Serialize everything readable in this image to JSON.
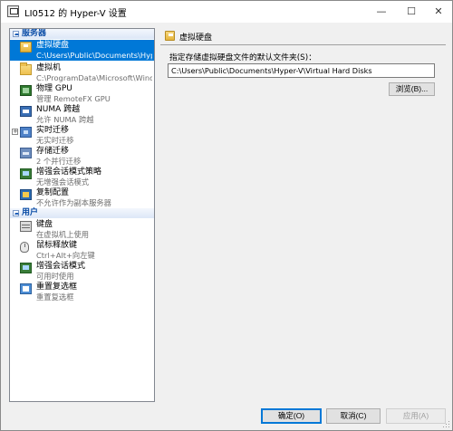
{
  "window": {
    "title": "LI0512 的 Hyper-V 设置",
    "controls": {
      "minimize": "—",
      "maximize": "☐",
      "close": "✕"
    }
  },
  "sidebar": {
    "sections": [
      {
        "label": "服务器"
      },
      {
        "label": "用户"
      }
    ],
    "items": [
      {
        "name": "虚拟硬盘",
        "sub": "C:\\Users\\Public\\Documents\\Hyper-...",
        "icon": "virtual-disk-icon",
        "selected": true
      },
      {
        "name": "虚拟机",
        "sub": "C:\\ProgramData\\Microsoft\\Windo...",
        "icon": "folder-icon"
      },
      {
        "name": "物理 GPU",
        "sub": "管理 RemoteFX GPU",
        "icon": "gpu-icon"
      },
      {
        "name": "NUMA 跨越",
        "sub": "允许 NUMA 跨越",
        "icon": "numa-icon"
      },
      {
        "name": "实时迁移",
        "sub": "无实时迁移",
        "icon": "live-migration-icon",
        "expandable": true
      },
      {
        "name": "存储迁移",
        "sub": "2 个并行迁移",
        "icon": "storage-migration-icon"
      },
      {
        "name": "增强会话模式策略",
        "sub": "无增强会话模式",
        "icon": "session-policy-icon"
      },
      {
        "name": "复制配置",
        "sub": "不允许作为副本服务器",
        "icon": "replication-icon"
      },
      {
        "name": "键盘",
        "sub": "在虚拟机上使用",
        "icon": "keyboard-icon"
      },
      {
        "name": "鼠标释放键",
        "sub": "Ctrl+Alt+向左键",
        "icon": "mouse-icon"
      },
      {
        "name": "增强会话模式",
        "sub": "可用时使用",
        "icon": "enhanced-session-icon"
      },
      {
        "name": "重置复选框",
        "sub": "重置复选框",
        "icon": "reset-checkbox-icon"
      }
    ]
  },
  "main": {
    "title": "虚拟硬盘",
    "field_label": "指定存储虚拟硬盘文件的默认文件夹(S)：",
    "path_value": "C:\\Users\\Public\\Documents\\Hyper-V\\Virtual Hard Disks",
    "browse_label": "浏览(B)..."
  },
  "footer": {
    "ok_label": "确定(O)",
    "cancel_label": "取消(C)",
    "apply_label": "应用(A)"
  },
  "colors": {
    "selection": "#0078d7",
    "section_text": "#0c4ea7"
  }
}
